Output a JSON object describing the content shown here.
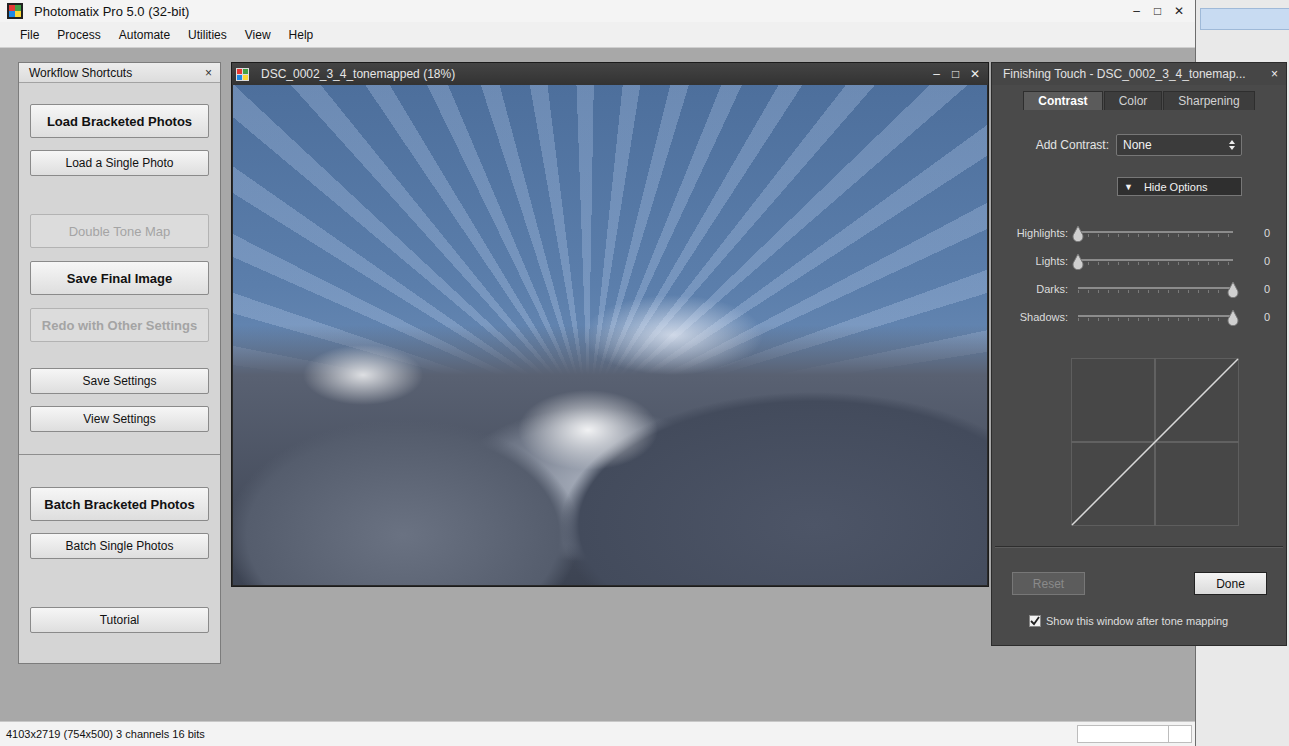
{
  "window": {
    "title": "Photomatix Pro 5.0 (32-bit)",
    "controls": [
      "–",
      "□",
      "✕"
    ]
  },
  "menu": [
    "File",
    "Process",
    "Automate",
    "Utilities",
    "View",
    "Help"
  ],
  "workflow_panel": {
    "title": "Workflow Shortcuts",
    "close": "×",
    "parts": [
      [
        [
          {
            "label": "Load Bracketed Photos",
            "kind": "large",
            "bold": true,
            "disabled": false
          },
          {
            "label": "Load a Single Photo",
            "kind": "small",
            "bold": false,
            "disabled": false
          }
        ],
        [
          {
            "label": "Double Tone Map",
            "kind": "large",
            "bold": false,
            "disabled": true
          },
          {
            "label": "Save Final Image",
            "kind": "large",
            "bold": true,
            "disabled": false
          },
          {
            "label": "Redo with Other Settings",
            "kind": "large",
            "bold": true,
            "disabled": true
          }
        ],
        [
          {
            "label": "Save Settings",
            "kind": "small",
            "bold": false,
            "disabled": false
          },
          {
            "label": "View Settings",
            "kind": "small",
            "bold": false,
            "disabled": false
          }
        ]
      ],
      [
        [
          {
            "label": "Batch Bracketed Photos",
            "kind": "large",
            "bold": true,
            "disabled": false
          },
          {
            "label": "Batch Single Photos",
            "kind": "small",
            "bold": false,
            "disabled": false
          }
        ],
        [
          {
            "label": "Tutorial",
            "kind": "small",
            "bold": false,
            "disabled": false
          }
        ]
      ]
    ]
  },
  "image_window": {
    "title": "DSC_0002_3_4_tonemapped (18%)",
    "controls": [
      "–",
      "□",
      "✕"
    ]
  },
  "finishing_touch": {
    "title": "Finishing Touch - DSC_0002_3_4_tonemap...",
    "close": "×",
    "tabs": [
      {
        "label": "Contrast",
        "selected": true
      },
      {
        "label": "Color",
        "selected": false
      },
      {
        "label": "Sharpening",
        "selected": false
      }
    ],
    "add_contrast": {
      "label": "Add Contrast:",
      "value": "None"
    },
    "options_button": {
      "icon": "▼",
      "label": "Hide Options"
    },
    "sliders": [
      {
        "label": "Highlights:",
        "level": 0,
        "reading": "0"
      },
      {
        "label": "Lights:",
        "level": 0,
        "reading": "0"
      },
      {
        "label": "Darks:",
        "level": 1,
        "reading": "0"
      },
      {
        "label": "Shadows:",
        "level": 1,
        "reading": "0"
      }
    ],
    "buttons": [
      {
        "label": "Reset",
        "disabled": true
      },
      {
        "label": "Done",
        "disabled": false
      }
    ],
    "show_after": {
      "label": "Show this window after tone mapping",
      "checked": true
    }
  },
  "status_bar": {
    "text": "4103x2719 (754x500) 3 channels 16 bits"
  }
}
